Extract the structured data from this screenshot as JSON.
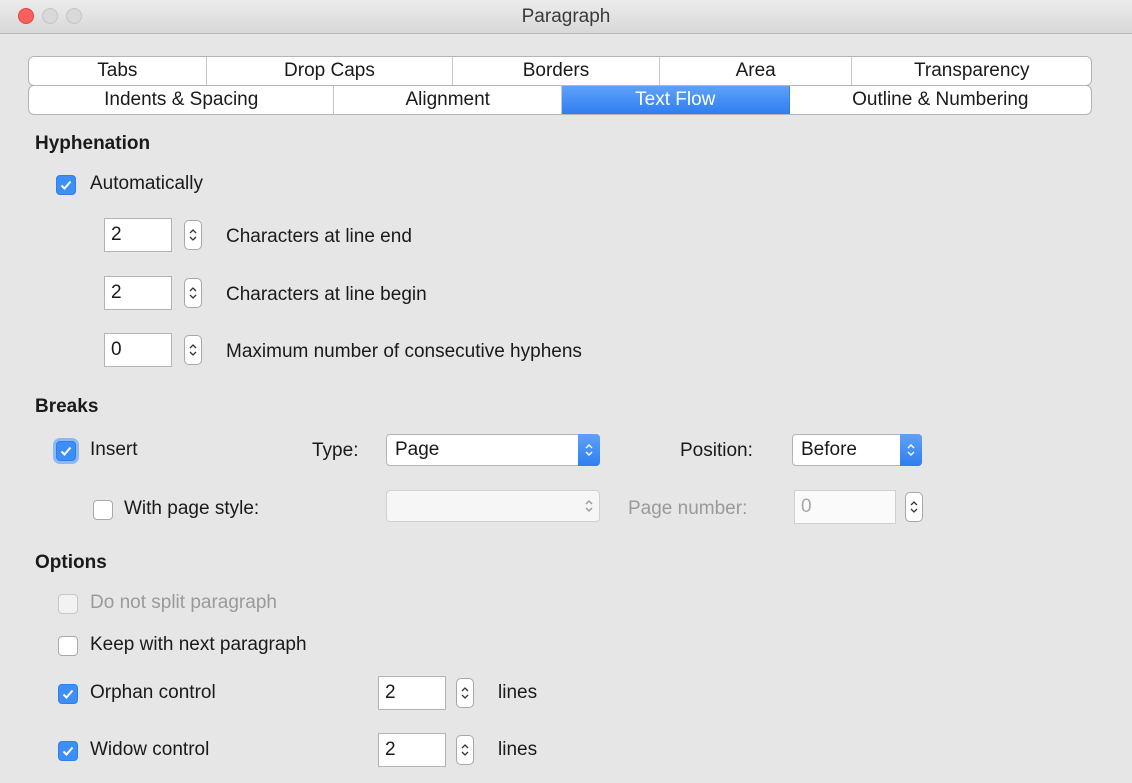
{
  "window": {
    "title": "Paragraph"
  },
  "tabs": {
    "row1": [
      "Tabs",
      "Drop Caps",
      "Borders",
      "Area",
      "Transparency"
    ],
    "row2": [
      "Indents & Spacing",
      "Alignment",
      "Text Flow",
      "Outline & Numbering"
    ],
    "active": "Text Flow"
  },
  "hyphenation": {
    "heading": "Hyphenation",
    "automatically": {
      "label": "Automatically",
      "checked": true
    },
    "line_end": {
      "value": "2",
      "label": "Characters at line end"
    },
    "line_begin": {
      "value": "2",
      "label": "Characters at line begin"
    },
    "max_hyphens": {
      "value": "0",
      "label": "Maximum number of consecutive hyphens"
    }
  },
  "breaks": {
    "heading": "Breaks",
    "insert": {
      "label": "Insert",
      "checked": true
    },
    "type_label": "Type:",
    "type_value": "Page",
    "position_label": "Position:",
    "position_value": "Before",
    "with_page_style": {
      "label": "With page style:",
      "checked": false
    },
    "page_style_value": "",
    "page_number_label": "Page number:",
    "page_number_value": "0"
  },
  "options": {
    "heading": "Options",
    "do_not_split": {
      "label": "Do not split paragraph",
      "checked": false,
      "enabled": false
    },
    "keep_with_next": {
      "label": "Keep with next paragraph",
      "checked": false
    },
    "orphan": {
      "label": "Orphan control",
      "checked": true,
      "value": "2",
      "unit": "lines"
    },
    "widow": {
      "label": "Widow control",
      "checked": true,
      "value": "2",
      "unit": "lines"
    }
  },
  "colors": {
    "accent": "#3d8ef7",
    "background": "#e6e6e6",
    "close": "#fc605c"
  },
  "icons": [
    "close-icon",
    "minimize-icon",
    "maximize-icon",
    "checkmark-icon",
    "stepper-icon",
    "dropdown-arrow-icon"
  ]
}
